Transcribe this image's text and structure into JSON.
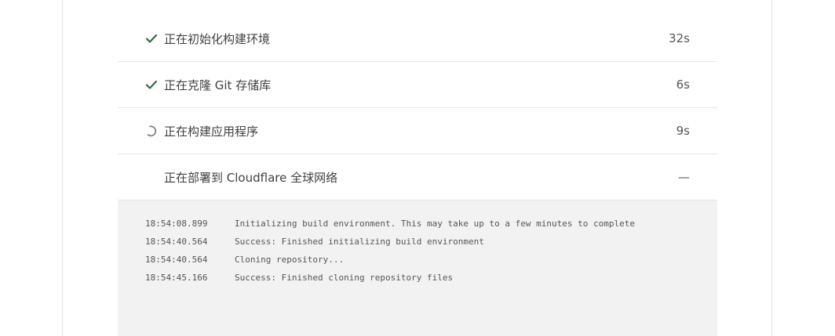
{
  "steps": [
    {
      "label": "正在初始化构建环境",
      "time": "32s",
      "status": "done"
    },
    {
      "label": "正在克隆 Git 存储库",
      "time": "6s",
      "status": "done"
    },
    {
      "label": "正在构建应用程序",
      "time": "9s",
      "status": "running"
    },
    {
      "label": "正在部署到 Cloudflare 全球网络",
      "time": "—",
      "status": "pending"
    }
  ],
  "log": [
    {
      "ts": "18:54:08.899",
      "msg": "Initializing build environment. This may take up to a few minutes to complete"
    },
    {
      "ts": "18:54:40.564",
      "msg": "Success: Finished initializing build environment"
    },
    {
      "ts": "18:54:40.564",
      "msg": "Cloning repository..."
    },
    {
      "ts": "18:54:45.166",
      "msg": "Success: Finished cloning repository files"
    }
  ],
  "colors": {
    "check": "#2e6b46",
    "spinner": "#777777",
    "log_bg": "#f2f2f2"
  }
}
